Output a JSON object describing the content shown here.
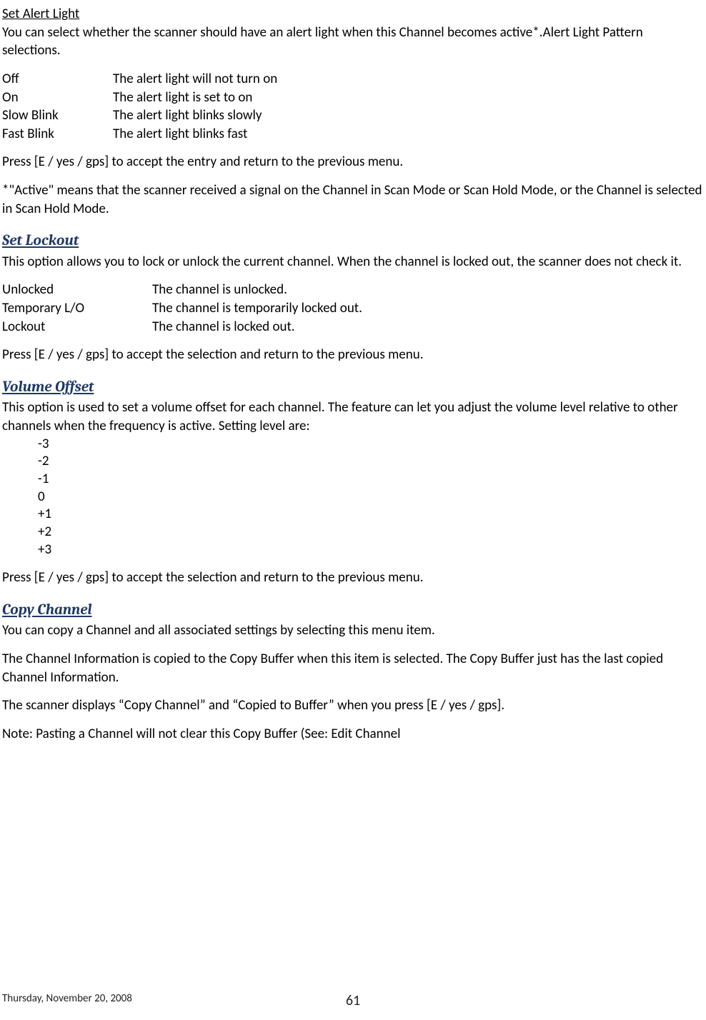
{
  "section1": {
    "title": "Set Alert Light",
    "intro": "You can select whether the scanner should have an alert light when this Channel becomes active*.Alert Light Pattern selections.",
    "options": [
      {
        "label": "Off",
        "desc": "The alert light will not turn on"
      },
      {
        "label": "On",
        "desc": "The alert light is set to on"
      },
      {
        "label": "Slow Blink",
        "desc": "The alert light blinks slowly"
      },
      {
        "label": "Fast Blink",
        "desc": "The alert light blinks fast"
      }
    ],
    "accept": "Press [E / yes / gps] to accept the entry and return to the previous menu.",
    "footnote": "*\"Active\" means that the scanner received a signal on the Channel in Scan Mode or Scan Hold Mode, or the Channel is selected in Scan Hold Mode."
  },
  "section2": {
    "title": "Set Lockout",
    "intro": "This option allows you to lock or unlock the current channel. When the channel is locked out, the scanner does not check it.",
    "options": [
      {
        "label": "Unlocked",
        "desc": "The channel is unlocked."
      },
      {
        "label": "Temporary L/O",
        "desc": "The channel is temporarily locked out."
      },
      {
        "label": "Lockout",
        "desc": "The channel is locked out."
      }
    ],
    "accept": "Press [E / yes / gps] to accept the selection and return to the previous menu."
  },
  "section3": {
    "title": "Volume Offset",
    "intro": "This option is used to set a volume offset for each channel. The feature can let you adjust the volume level relative to other channels when the frequency is active. Setting level are:",
    "levels": [
      "-3",
      "-2",
      "-1",
      " 0",
      "+1",
      "+2",
      "+3"
    ],
    "accept": "Press [E / yes / gps] to accept the selection and return to the previous menu."
  },
  "section4": {
    "title": "Copy Channel",
    "p1": "You can copy a Channel and all associated settings by selecting this menu item.",
    "p2": "The Channel Information is copied to the Copy Buffer when this item is selected. The Copy Buffer just has the last copied Channel Information.",
    "p3": "The scanner displays “Copy Channel” and “Copied to Buffer” when you press [E / yes / gps].",
    "p4": "Note: Pasting a Channel will not clear this Copy Buffer (See: Edit Channel"
  },
  "footer": {
    "date": "Thursday, November 20, 2008",
    "page": "61"
  }
}
